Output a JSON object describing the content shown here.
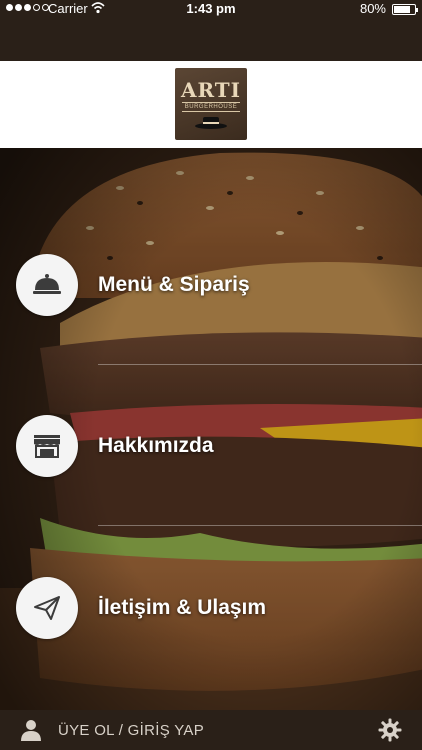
{
  "status_bar": {
    "carrier": "Carrier",
    "time": "1:43 pm",
    "battery": "80%",
    "battery_level": 0.8,
    "signal_bars": 3
  },
  "logo": {
    "brand": "ARTI",
    "sub": "BURGERHOUSE"
  },
  "menu": [
    {
      "label": "Menü & Sipariş",
      "icon": "cloche-icon"
    },
    {
      "label": "Hakkımızda",
      "icon": "store-icon"
    },
    {
      "label": "İletişim & Ulaşım",
      "icon": "paper-plane-icon"
    }
  ],
  "bottom_bar": {
    "login_label": "ÜYE OL / GİRİŞ YAP",
    "user_icon": "user-icon",
    "settings_icon": "gear-icon"
  },
  "colors": {
    "dark": "#2a2018",
    "circle": "#f4f4f4",
    "icon": "#3c3c3c"
  }
}
